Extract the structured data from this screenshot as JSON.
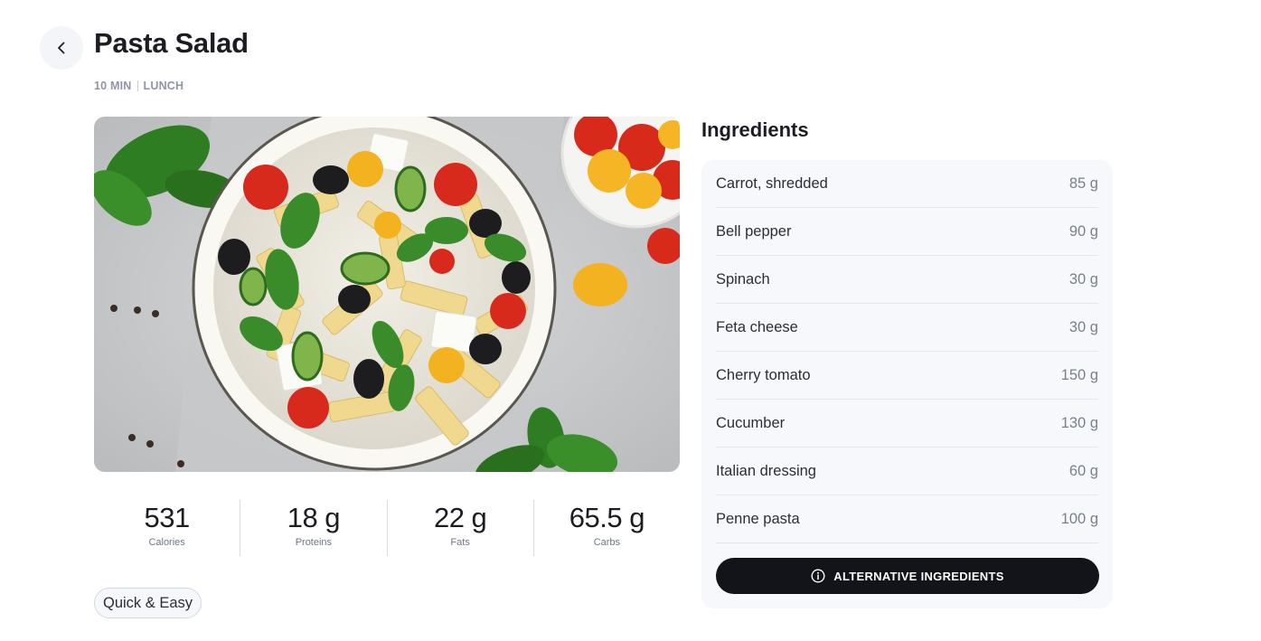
{
  "header": {
    "title": "Pasta Salad",
    "time": "10 MIN",
    "meal": "LUNCH"
  },
  "nutrition": [
    {
      "value": "531",
      "label": "Calories"
    },
    {
      "value": "18 g",
      "label": "Proteins"
    },
    {
      "value": "22 g",
      "label": "Fats"
    },
    {
      "value": "65.5 g",
      "label": "Carbs"
    }
  ],
  "tags": [
    "Quick & Easy"
  ],
  "ingredients": {
    "title": "Ingredients",
    "items": [
      {
        "name": "Carrot, shredded",
        "amount": "85 g"
      },
      {
        "name": "Bell pepper",
        "amount": "90 g"
      },
      {
        "name": "Spinach",
        "amount": "30 g"
      },
      {
        "name": "Feta cheese",
        "amount": "30 g"
      },
      {
        "name": "Cherry tomato",
        "amount": "150 g"
      },
      {
        "name": "Cucumber",
        "amount": "130 g"
      },
      {
        "name": "Italian dressing",
        "amount": "60 g"
      },
      {
        "name": "Penne pasta",
        "amount": "100 g"
      }
    ],
    "alt_button": "ALTERNATIVE INGREDIENTS"
  },
  "icons": {
    "back": "chevron-left-icon",
    "info": "info-icon"
  },
  "colors": {
    "primary_button": "#121419",
    "panel_bg": "#f6f8fc",
    "muted_text": "#8f96a3"
  }
}
